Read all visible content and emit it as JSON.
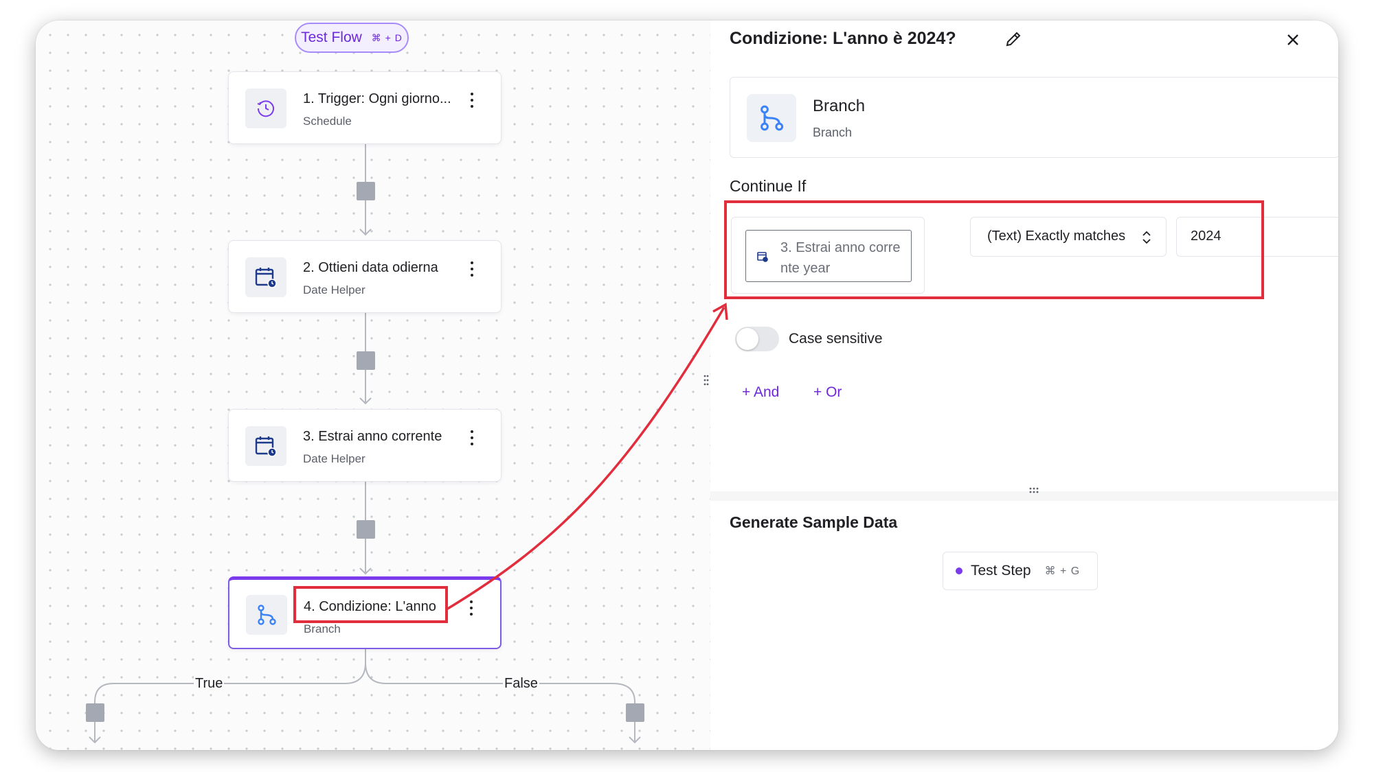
{
  "toolbar": {
    "test_flow_label": "Test Flow",
    "test_flow_shortcut": "⌘ + D"
  },
  "steps": [
    {
      "title": "1. Trigger: Ogni giorno...",
      "subtitle": "Schedule",
      "icon": "clock-icon"
    },
    {
      "title": "2. Ottieni data odierna",
      "subtitle": "Date Helper",
      "icon": "calendar-clock-icon"
    },
    {
      "title": "3. Estrai anno corrente",
      "subtitle": "Date Helper",
      "icon": "calendar-clock-icon"
    },
    {
      "title": "4. Condizione: L'anno",
      "subtitle": "Branch",
      "icon": "branch-icon"
    }
  ],
  "branches": {
    "true_label": "True",
    "false_label": "False"
  },
  "panel": {
    "title": "Condizione: L'anno è 2024?",
    "piece": {
      "name": "Branch",
      "subtitle": "Branch"
    },
    "continue_if_label": "Continue If",
    "condition": {
      "left_chip": "3. Estrai anno corrente year",
      "operator": "(Text) Exactly matches",
      "value": "2024"
    },
    "case_sensitive_label": "Case sensitive",
    "case_sensitive_on": false,
    "add_and_label": "+ And",
    "add_or_label": "+ Or",
    "sample_data_title": "Generate Sample Data",
    "test_step_label": "Test Step",
    "test_step_shortcut": "⌘ + G"
  },
  "colors": {
    "accent": "#7c3aed",
    "annotation_red": "#e22d3d",
    "step_icon_blue": "#1e3a8a",
    "branch_icon_blue": "#3b82f6"
  }
}
